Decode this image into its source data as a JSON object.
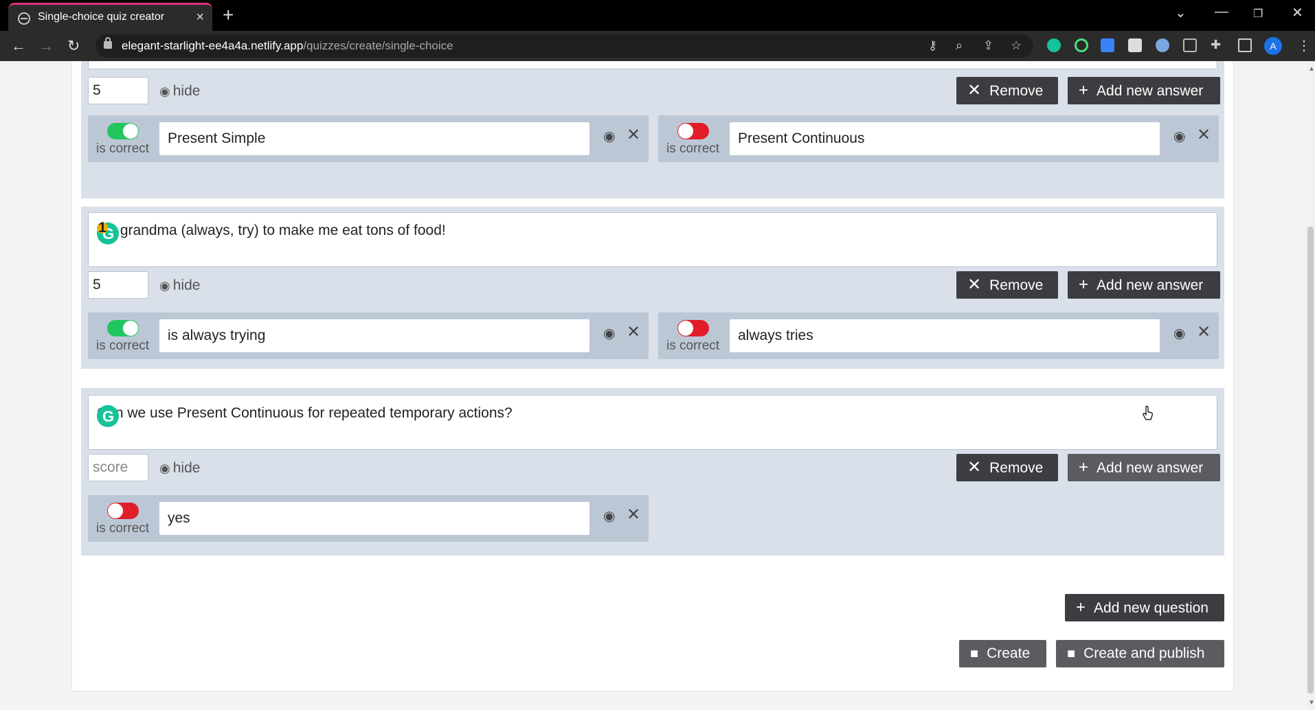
{
  "browser": {
    "tab_title": "Single-choice quiz creator",
    "url_domain": "elegant-starlight-ee4a4a.netlify.app",
    "url_path": "/quizzes/create/single-choice",
    "avatar_letter": "A"
  },
  "common": {
    "hide_label": "hide",
    "remove_label": "Remove",
    "add_answer_label": "Add new answer",
    "is_correct_label": "is correct"
  },
  "questions": [
    {
      "score": "5",
      "answers": [
        {
          "text": "Present Simple",
          "correct": true
        },
        {
          "text": "Present Continuous",
          "correct": false
        }
      ]
    },
    {
      "text": "My grandma (always, try) to make me eat tons of food!",
      "grammarly_badge": "1",
      "score": "5",
      "answers": [
        {
          "text": "is always trying",
          "correct": true
        },
        {
          "text": "always tries",
          "correct": false
        }
      ]
    },
    {
      "text": "Can we use Present Continuous for repeated temporary actions?",
      "score_placeholder": "score",
      "answers": [
        {
          "text": "yes",
          "correct": false
        }
      ]
    }
  ],
  "footer": {
    "add_question_label": "Add new question",
    "create_label": "Create",
    "create_publish_label": "Create and publish"
  },
  "colors": {
    "accent_tab": "#e4307d",
    "toggle_on": "#22c55e",
    "toggle_off": "#e11d2a",
    "button_dark": "#3b3d40",
    "grammarly": "#15c39a"
  }
}
